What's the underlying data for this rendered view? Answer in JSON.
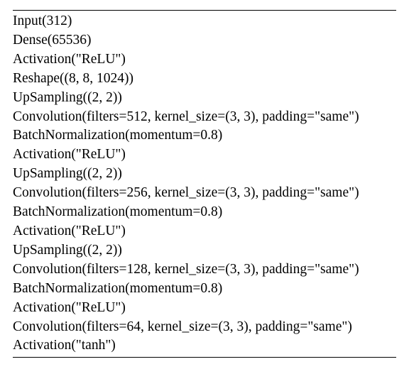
{
  "layers": [
    "Input(312)",
    "Dense(65536)",
    "Activation(\"ReLU\")",
    "Reshape((8, 8, 1024))",
    "UpSampling((2, 2))",
    "Convolution(filters=512, kernel_size=(3, 3), padding=\"same\")",
    "BatchNormalization(momentum=0.8)",
    "Activation(\"ReLU\")",
    "UpSampling((2, 2))",
    "Convolution(filters=256, kernel_size=(3, 3), padding=\"same\")",
    "BatchNormalization(momentum=0.8)",
    "Activation(\"ReLU\")",
    "UpSampling((2, 2))",
    "Convolution(filters=128, kernel_size=(3, 3), padding=\"same\")",
    "BatchNormalization(momentum=0.8)",
    "Activation(\"ReLU\")",
    "Convolution(filters=64, kernel_size=(3, 3), padding=\"same\")",
    "Activation(\"tanh\")"
  ]
}
